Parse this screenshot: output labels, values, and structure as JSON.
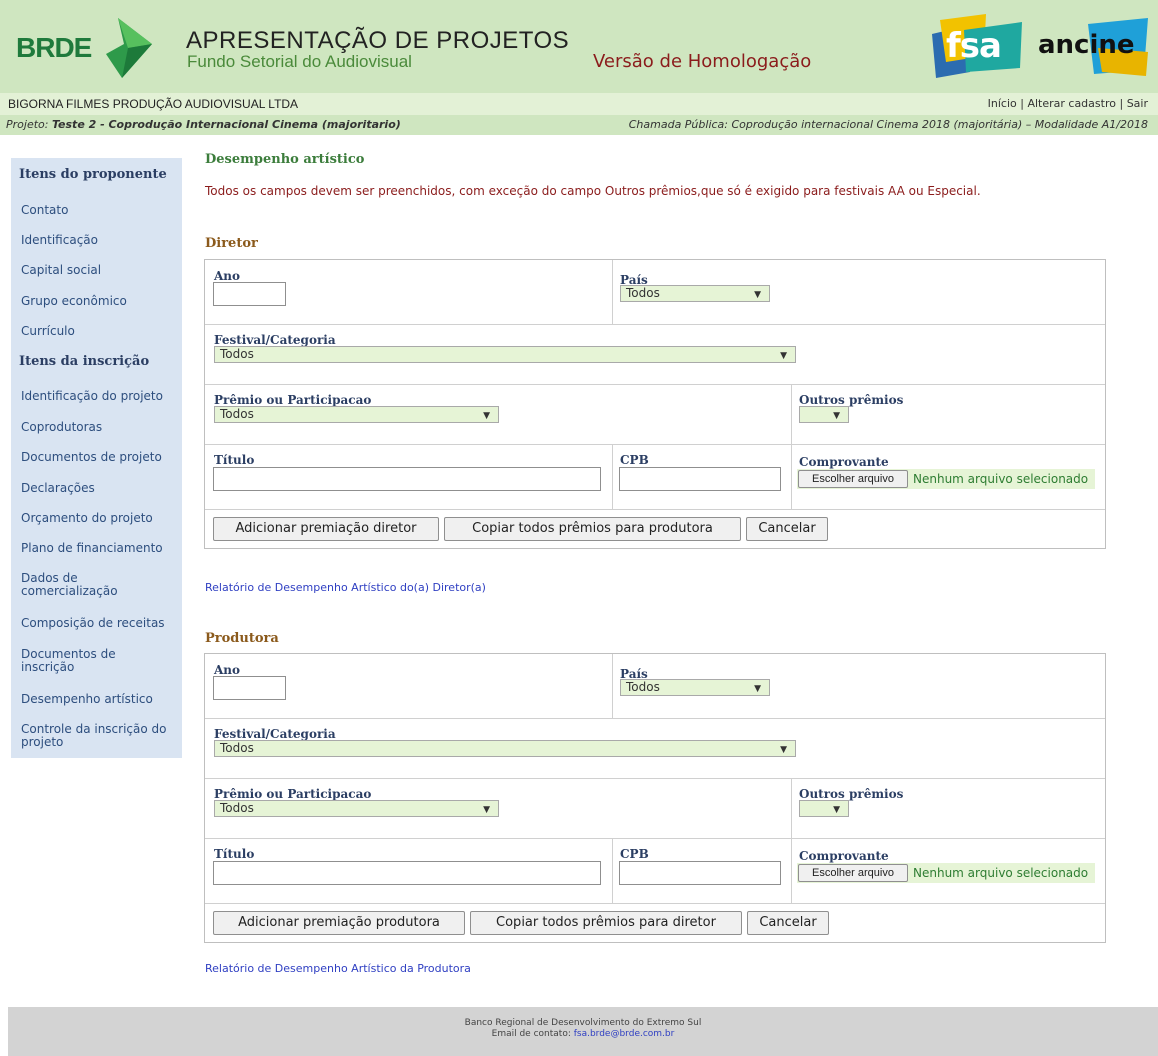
{
  "header": {
    "brde_logo": "BRDE",
    "title": "APRESENTAÇÃO DE PROJETOS",
    "subtitle": "Fundo Setorial do Audiovisual",
    "version": "Versão de Homologação",
    "fsa_logo": "fsa",
    "ancine_logo": "ancine",
    "colors": {
      "header_bg": "#cfe6c0",
      "version_text": "#8b1c1c",
      "brde_green": "#1f7a3c"
    }
  },
  "company_bar": {
    "company": "BIGORNA FILMES PRODUÇÃO AUDIOVISUAL LTDA",
    "links": {
      "inicio": "Início",
      "alterar": "Alterar cadastro",
      "sair": "Sair"
    },
    "separator": "|"
  },
  "project_bar": {
    "label": "Projeto:",
    "project": "Teste 2 - Coprodução Internacional Cinema (majoritario)",
    "call": "Chamada Pública: Coprodução internacional Cinema 2018 (majoritária) – Modalidade A1/2018"
  },
  "sidebar": {
    "heading_proponente": "Itens do proponente",
    "items_proponente": [
      "Contato",
      "Identificação",
      "Capital social",
      "Grupo econômico",
      "Currículo"
    ],
    "heading_inscricao": "Itens da inscrição",
    "items_inscricao": [
      "Identificação do projeto",
      "Coprodutoras",
      "Documentos de projeto",
      "Declarações",
      "Orçamento do projeto",
      "Plano de financiamento",
      "Dados de comercialização",
      "Composição de receitas",
      "Documentos de inscrição",
      "Desempenho artístico",
      "Controle da inscrição do projeto"
    ]
  },
  "main": {
    "title": "Desempenho artístico",
    "notice": "Todos os campos devem ser preenchidos, com exceção do campo Outros prêmios,que só é exigido para festivais AA ou Especial.",
    "diretor": {
      "heading": "Diretor",
      "ano_label": "Ano",
      "ano_value": "",
      "pais_label": "País",
      "pais_value": "Todos",
      "festival_label": "Festival/Categoria",
      "festival_value": "Todos",
      "premio_label": "Prêmio ou Participacao",
      "premio_value": "Todos",
      "outros_label": "Outros prêmios",
      "outros_value": "",
      "titulo_label": "Título",
      "titulo_value": "",
      "cpb_label": "CPB",
      "cpb_value": "",
      "comprovante_label": "Comprovante",
      "file_button": "Escolher arquivo",
      "file_status": "Nenhum arquivo selecionado",
      "btn_add": "Adicionar premiação diretor",
      "btn_copy": "Copiar todos prêmios para produtora",
      "btn_cancel": "Cancelar",
      "report_link": "Relatório de Desempenho Artístico do(a) Diretor(a)"
    },
    "produtora": {
      "heading": "Produtora",
      "ano_label": "Ano",
      "ano_value": "",
      "pais_label": "País",
      "pais_value": "Todos",
      "festival_label": "Festival/Categoria",
      "festival_value": "Todos",
      "premio_label": "Prêmio ou Participacao",
      "premio_value": "Todos",
      "outros_label": "Outros prêmios",
      "outros_value": "",
      "titulo_label": "Título",
      "titulo_value": "",
      "cpb_label": "CPB",
      "cpb_value": "",
      "comprovante_label": "Comprovante",
      "file_button": "Escolher arquivo",
      "file_status": "Nenhum arquivo selecionado",
      "btn_add": "Adicionar premiação produtora",
      "btn_copy": "Copiar todos prêmios para diretor",
      "btn_cancel": "Cancelar",
      "report_link": "Relatório de Desempenho Artístico da Produtora"
    }
  },
  "footer": {
    "line1": "Banco Regional de Desenvolvimento do Extremo Sul",
    "email_label": "Email de contato:",
    "email": "fsa.brde@brde.com.br"
  }
}
